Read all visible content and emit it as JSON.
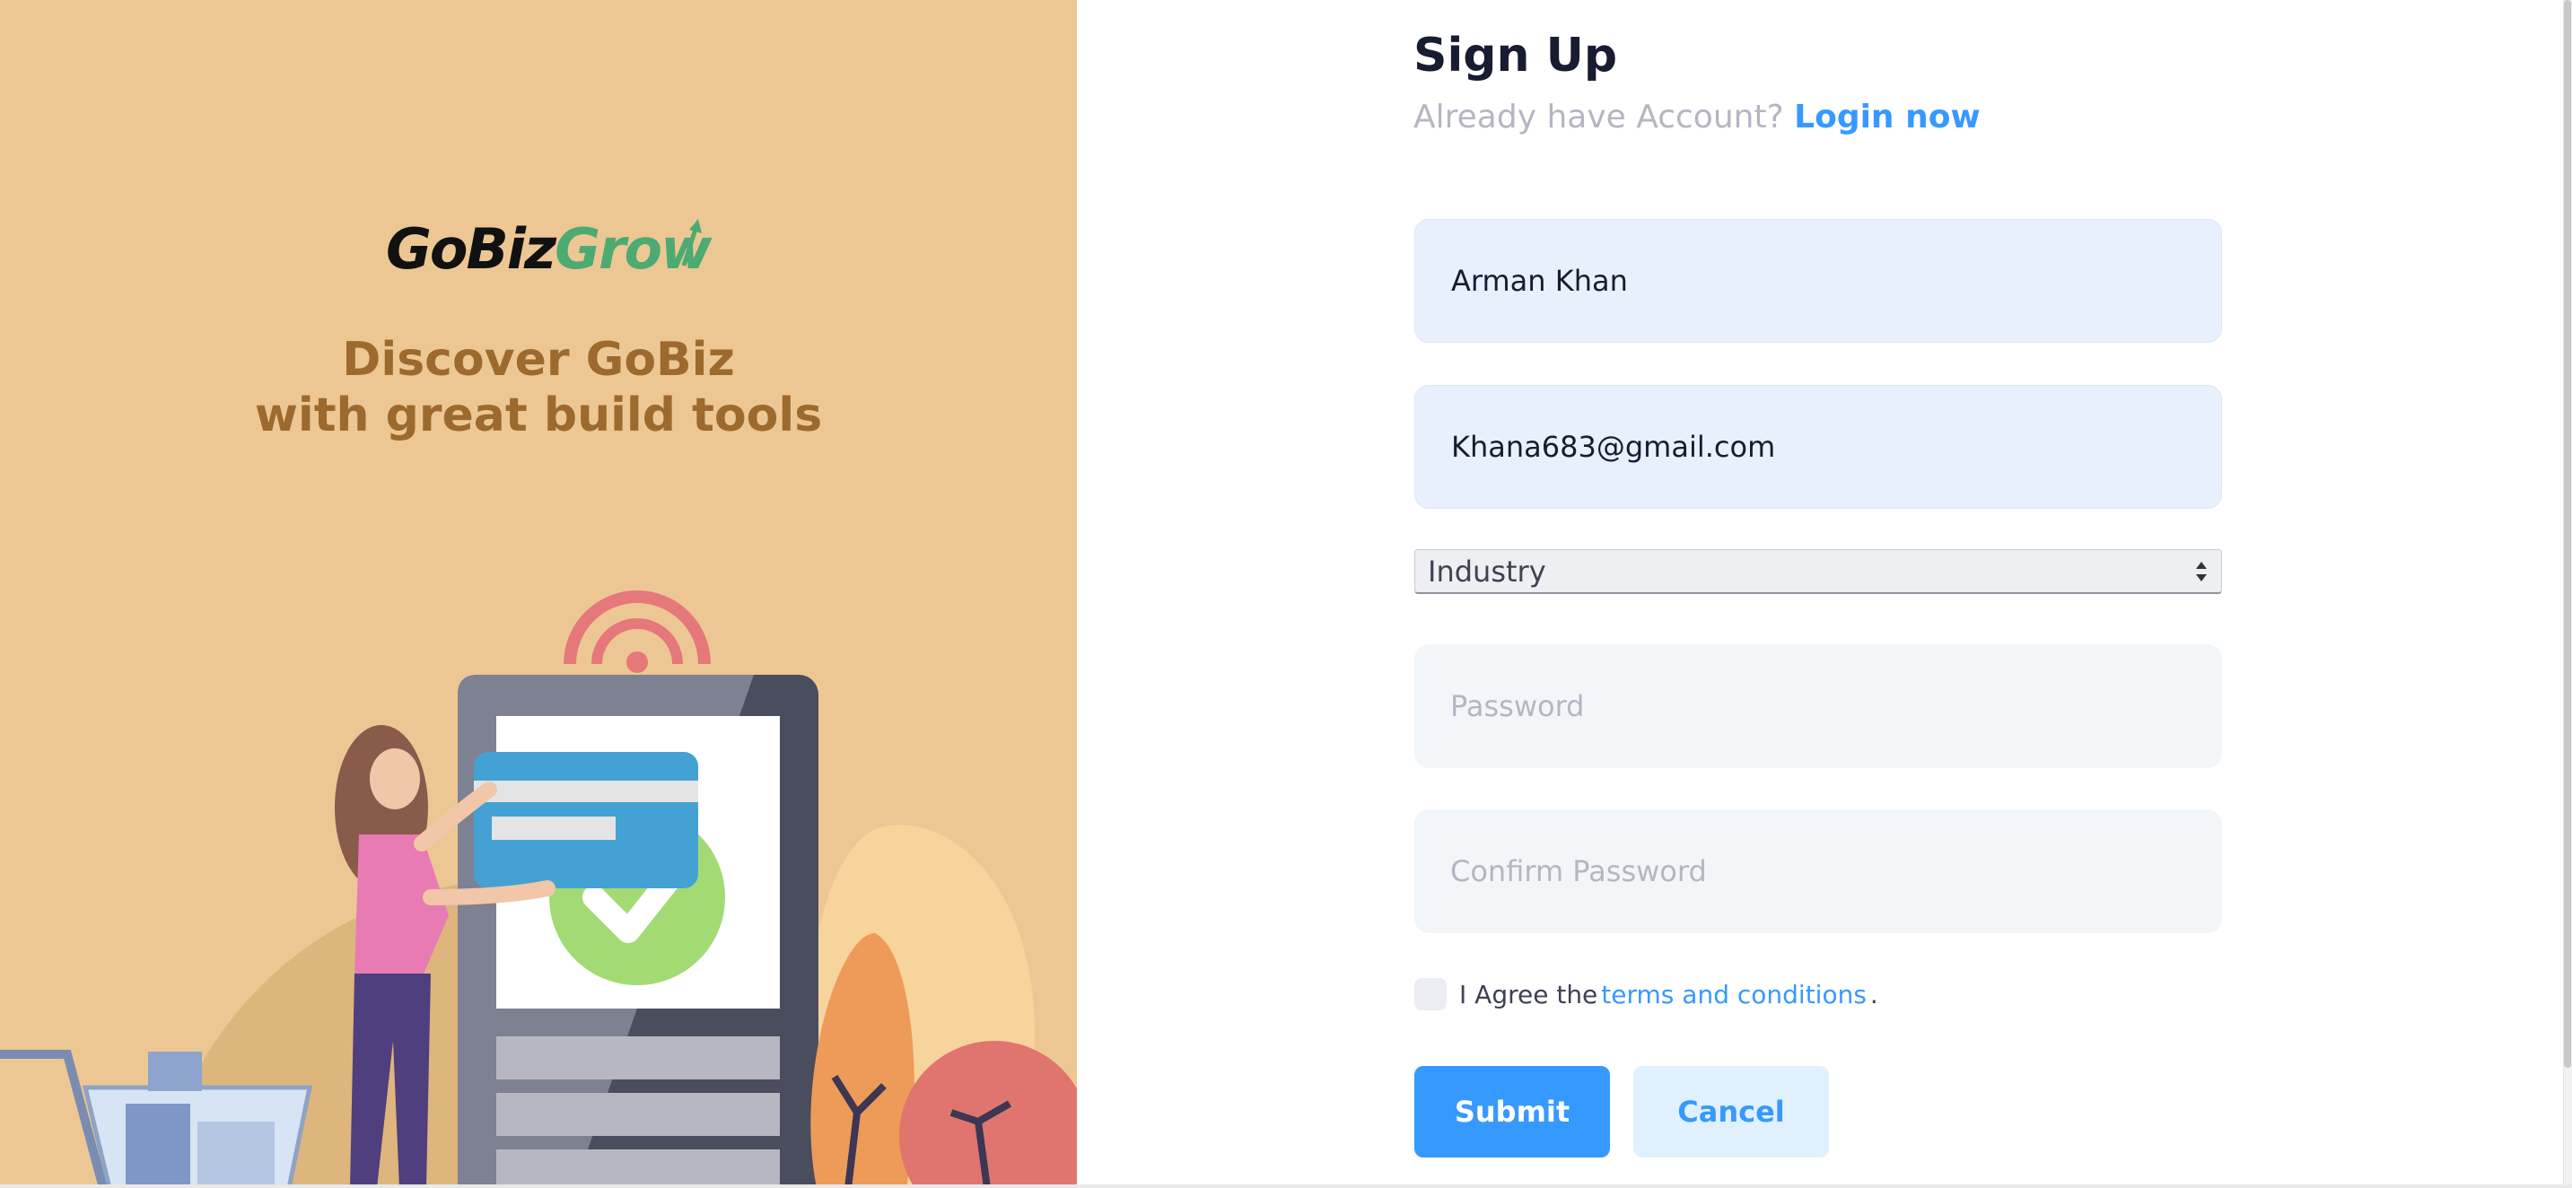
{
  "brand": {
    "logo_part_1": "GoBiz",
    "logo_part_2": "Grow"
  },
  "left_panel": {
    "tagline_line_1": "Discover GoBiz",
    "tagline_line_2": "with great build tools",
    "background_color": "#EDC793"
  },
  "form": {
    "title": "Sign Up",
    "subtitle_text": "Already have Account?",
    "login_link": "Login now",
    "fields": {
      "name": {
        "value": "Arman Khan"
      },
      "email": {
        "value": "Khana683@gmail.com"
      },
      "industry": {
        "selected": "Industry"
      },
      "password": {
        "placeholder": "Password",
        "value": ""
      },
      "confirm_password": {
        "placeholder": "Confirm Password",
        "value": ""
      }
    },
    "agree": {
      "prefix": "I Agree the",
      "link": "terms and conditions",
      "suffix": ".",
      "checked": false
    },
    "buttons": {
      "submit": "Submit",
      "cancel": "Cancel"
    }
  },
  "colors": {
    "accent": "#3699FF",
    "accent_light": "#E1F0FF",
    "filled_input": "#E8F0FE",
    "empty_input": "#F3F6F9",
    "logo_green": "#4DAA72",
    "tagline": "#9C6A2E"
  },
  "icons": {
    "select_arrows": "select-arrows-icon",
    "logo_arrow": "growth-arrow-icon"
  }
}
